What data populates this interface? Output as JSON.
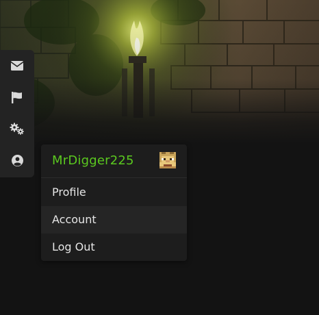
{
  "colors": {
    "background": "#131313",
    "rail": "#232323",
    "dropdown": "#1d1d1d",
    "dropdown_active": "#252525",
    "username": "#5bc91f",
    "item_text": "#e6e6e6",
    "icon": "#d9d9d9"
  },
  "sidebar": {
    "items": [
      {
        "icon": "envelope-icon"
      },
      {
        "icon": "flag-icon"
      },
      {
        "icon": "gears-icon"
      },
      {
        "icon": "user-circle-icon"
      }
    ]
  },
  "user_menu": {
    "username": "MrDigger225",
    "avatar": "minecraft-skin-avatar",
    "items": [
      {
        "label": "Profile",
        "active": false
      },
      {
        "label": "Account",
        "active": true
      },
      {
        "label": "Log Out",
        "active": false
      }
    ]
  }
}
